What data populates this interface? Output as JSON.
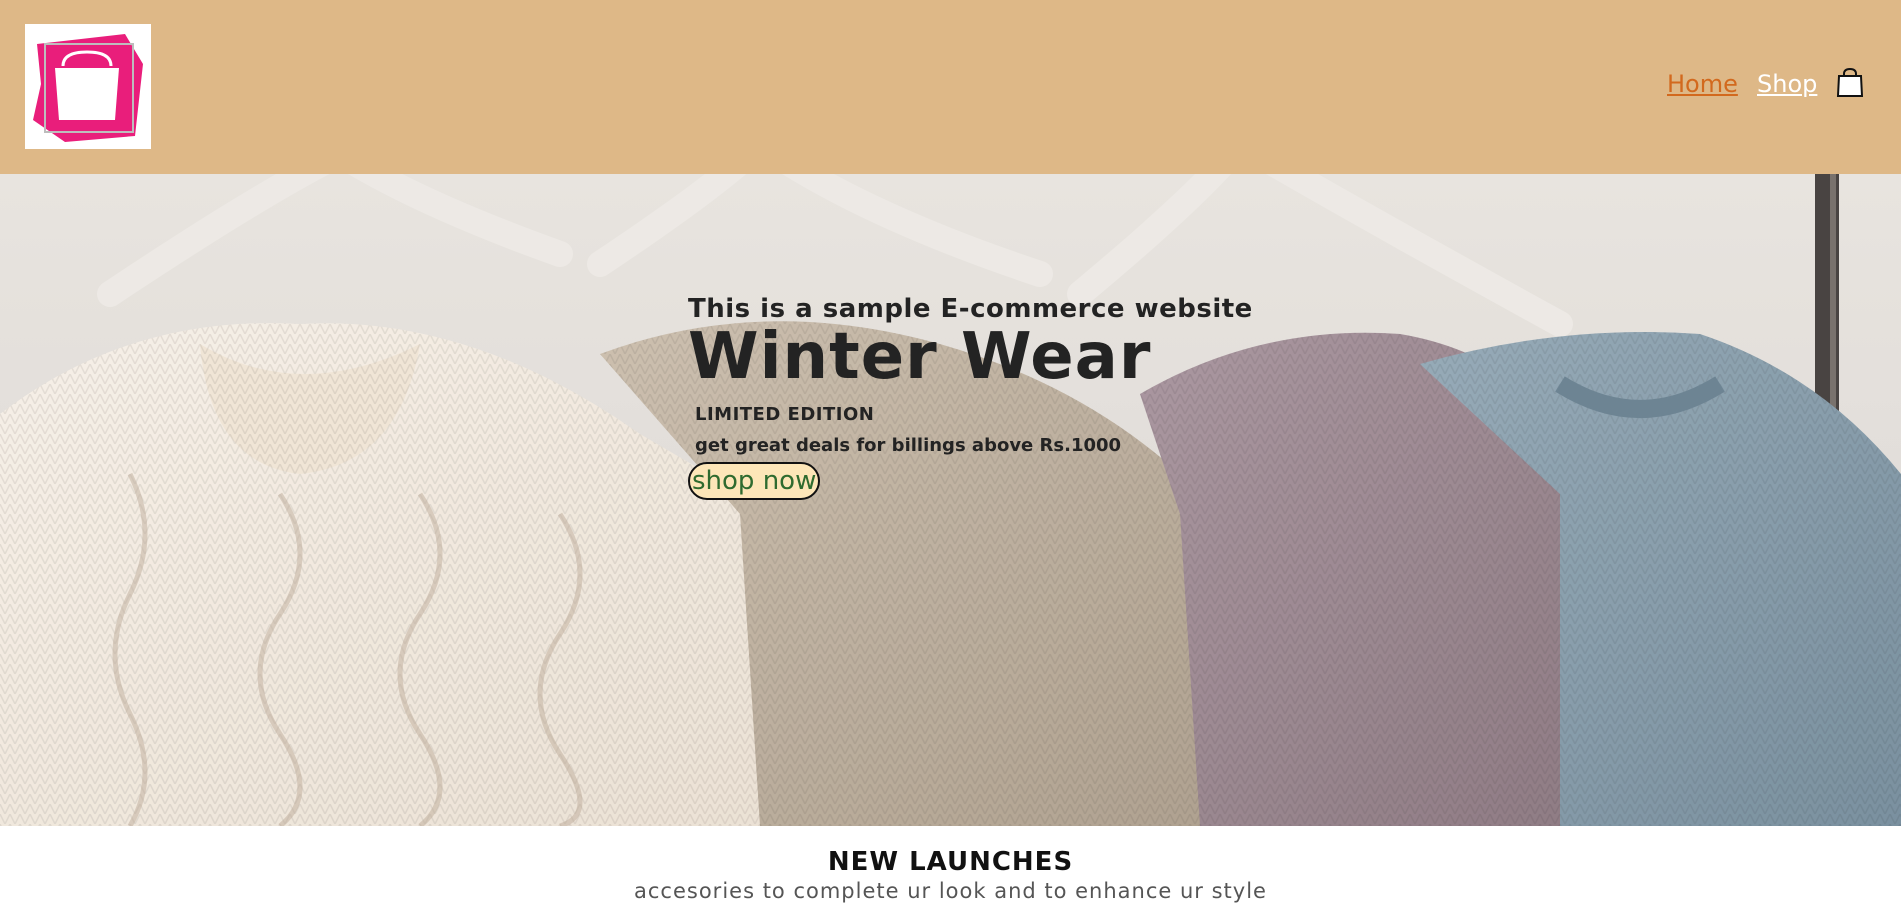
{
  "header": {
    "logo_icon": "shopping-bag-logo",
    "nav": {
      "home": "Home",
      "shop": "Shop",
      "cart_icon": "shopping-bag-icon"
    },
    "colors": {
      "header_bg": "#deb887",
      "home_link": "#d2691e",
      "shop_link": "#ffffff",
      "logo_pink": "#e91e7b"
    }
  },
  "hero": {
    "subtitle": "This is a sample E-commerce website",
    "title": "Winter Wear",
    "edition": "LIMITED EDITION",
    "deal": "get great deals for billings above Rs.1000",
    "button": "shop now",
    "colors": {
      "button_bg": "#fde6b8",
      "button_text": "#2f6b2f"
    }
  },
  "launches": {
    "heading": "NEW LAUNCHES",
    "subheading": "accesories to complete ur look and to enhance ur style"
  }
}
